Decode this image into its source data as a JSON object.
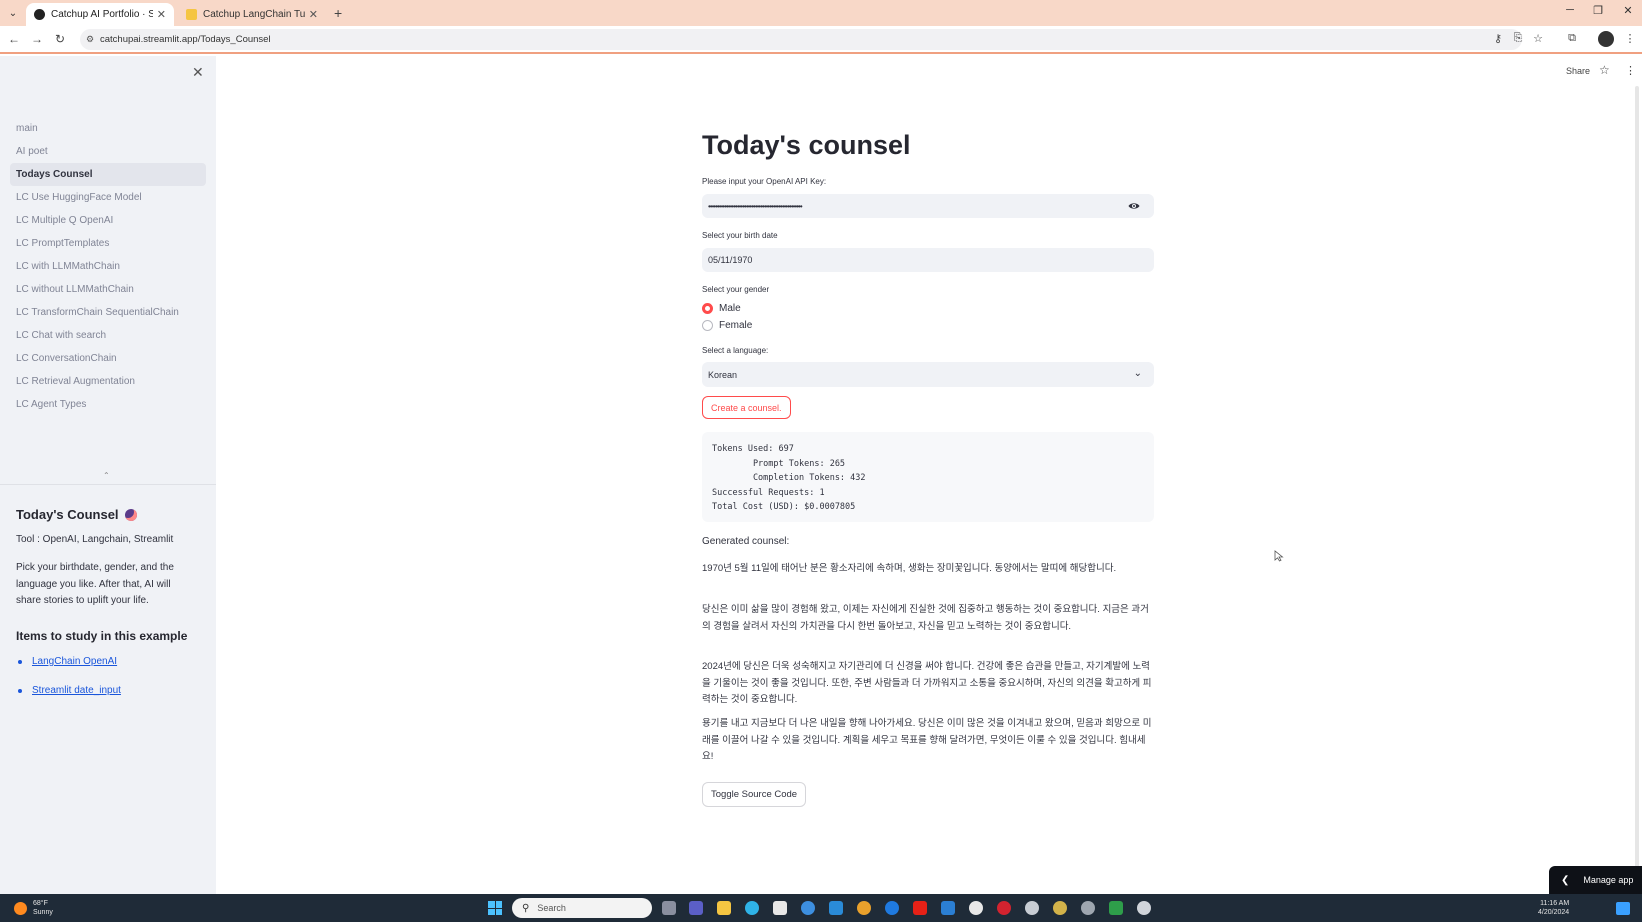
{
  "browser": {
    "tabs": [
      {
        "title": "Catchup AI Portfolio · Streamlit",
        "active": true
      },
      {
        "title": "Catchup LangChain Tutorial · S",
        "active": false
      }
    ],
    "url": "catchupai.streamlit.app/Todays_Counsel"
  },
  "sidebar": {
    "nav": [
      {
        "label": "main"
      },
      {
        "label": "AI poet"
      },
      {
        "label": "Todays Counsel",
        "active": true
      },
      {
        "label": "LC Use HuggingFace Model"
      },
      {
        "label": "LC Multiple Q OpenAI"
      },
      {
        "label": "LC PromptTemplates"
      },
      {
        "label": "LC with LLMMathChain"
      },
      {
        "label": "LC without LLMMathChain"
      },
      {
        "label": "LC TransformChain SequentialChain"
      },
      {
        "label": "LC Chat with search"
      },
      {
        "label": "LC ConversationChain"
      },
      {
        "label": "LC Retrieval Augmentation"
      },
      {
        "label": "LC Agent Types"
      }
    ],
    "title": "Today's Counsel",
    "tool": "Tool : OpenAI, Langchain, Streamlit",
    "description": "Pick your birthdate, gender, and the language you like. After that, AI will share stories to uplift your life.",
    "study_title": "Items to study in this example",
    "study_links": [
      "LangChain OpenAI",
      "Streamlit date_input"
    ]
  },
  "header": {
    "share": "Share"
  },
  "main": {
    "title": "Today's counsel",
    "api_label": "Please input your OpenAI API Key:",
    "api_value": "••••••••••••••••••••••••••••••••••••••••••••••••••••",
    "birth_label": "Select your birth date",
    "birth_value": "05/11/1970",
    "gender_label": "Select your gender",
    "gender_options": [
      "Male",
      "Female"
    ],
    "gender_selected": "Male",
    "language_label": "Select a language:",
    "language_value": "Korean",
    "create_button": "Create a counsel.",
    "usage_lines": [
      "Tokens Used: 697",
      "        Prompt Tokens: 265",
      "        Completion Tokens: 432",
      "Successful Requests: 1",
      "Total Cost (USD): $0.0007805"
    ],
    "generated_label": "Generated counsel:",
    "counsel_paragraphs": [
      "1970년 5월 11일에 태어난 분은 황소자리에 속하며, 생화는 장미꽃입니다. 동양에서는 말띠에 해당합니다.",
      "당신은 이미 삶을 많이 경험해 왔고, 이제는 자신에게 진실한 것에 집중하고 행동하는 것이 중요합니다. 지금은 과거의 경험을 살려서 자신의 가치관을 다시 한번 돌아보고, 자신을 믿고 노력하는 것이 중요합니다.",
      "2024년에 당신은 더욱 성숙해지고 자기관리에 더 신경을 써야 합니다. 건강에 좋은 습관을 만들고, 자기계발에 노력을 기울이는 것이 좋을 것입니다. 또한, 주변 사람들과 더 가까워지고 소통을 중요시하며, 자신의 의견을 확고하게 피력하는 것이 중요합니다.",
      "용기를 내고 지금보다 더 나은 내일을 향해 나아가세요. 당신은 이미 많은 것을 이겨내고 왔으며, 믿음과 희망으로 미래를 이끌어 나갈 수 있을 것입니다. 계획을 세우고 목표를 향해 달려가면, 무엇이든 이룰 수 있을 것입니다. 힘내세요!"
    ],
    "toggle_button": "Toggle Source Code",
    "manage_app": "Manage app"
  },
  "taskbar": {
    "temp": "68°F",
    "weather": "Sunny",
    "search_placeholder": "Search",
    "time": "11:16 AM",
    "date": "4/20/2024"
  },
  "colors": {
    "accent": "#ff4b4b",
    "link": "#1a56db",
    "sidebar_bg": "#f0f2f6",
    "tabbar_bg": "#f8d8c8",
    "taskbar_bg": "#1f2b38"
  }
}
